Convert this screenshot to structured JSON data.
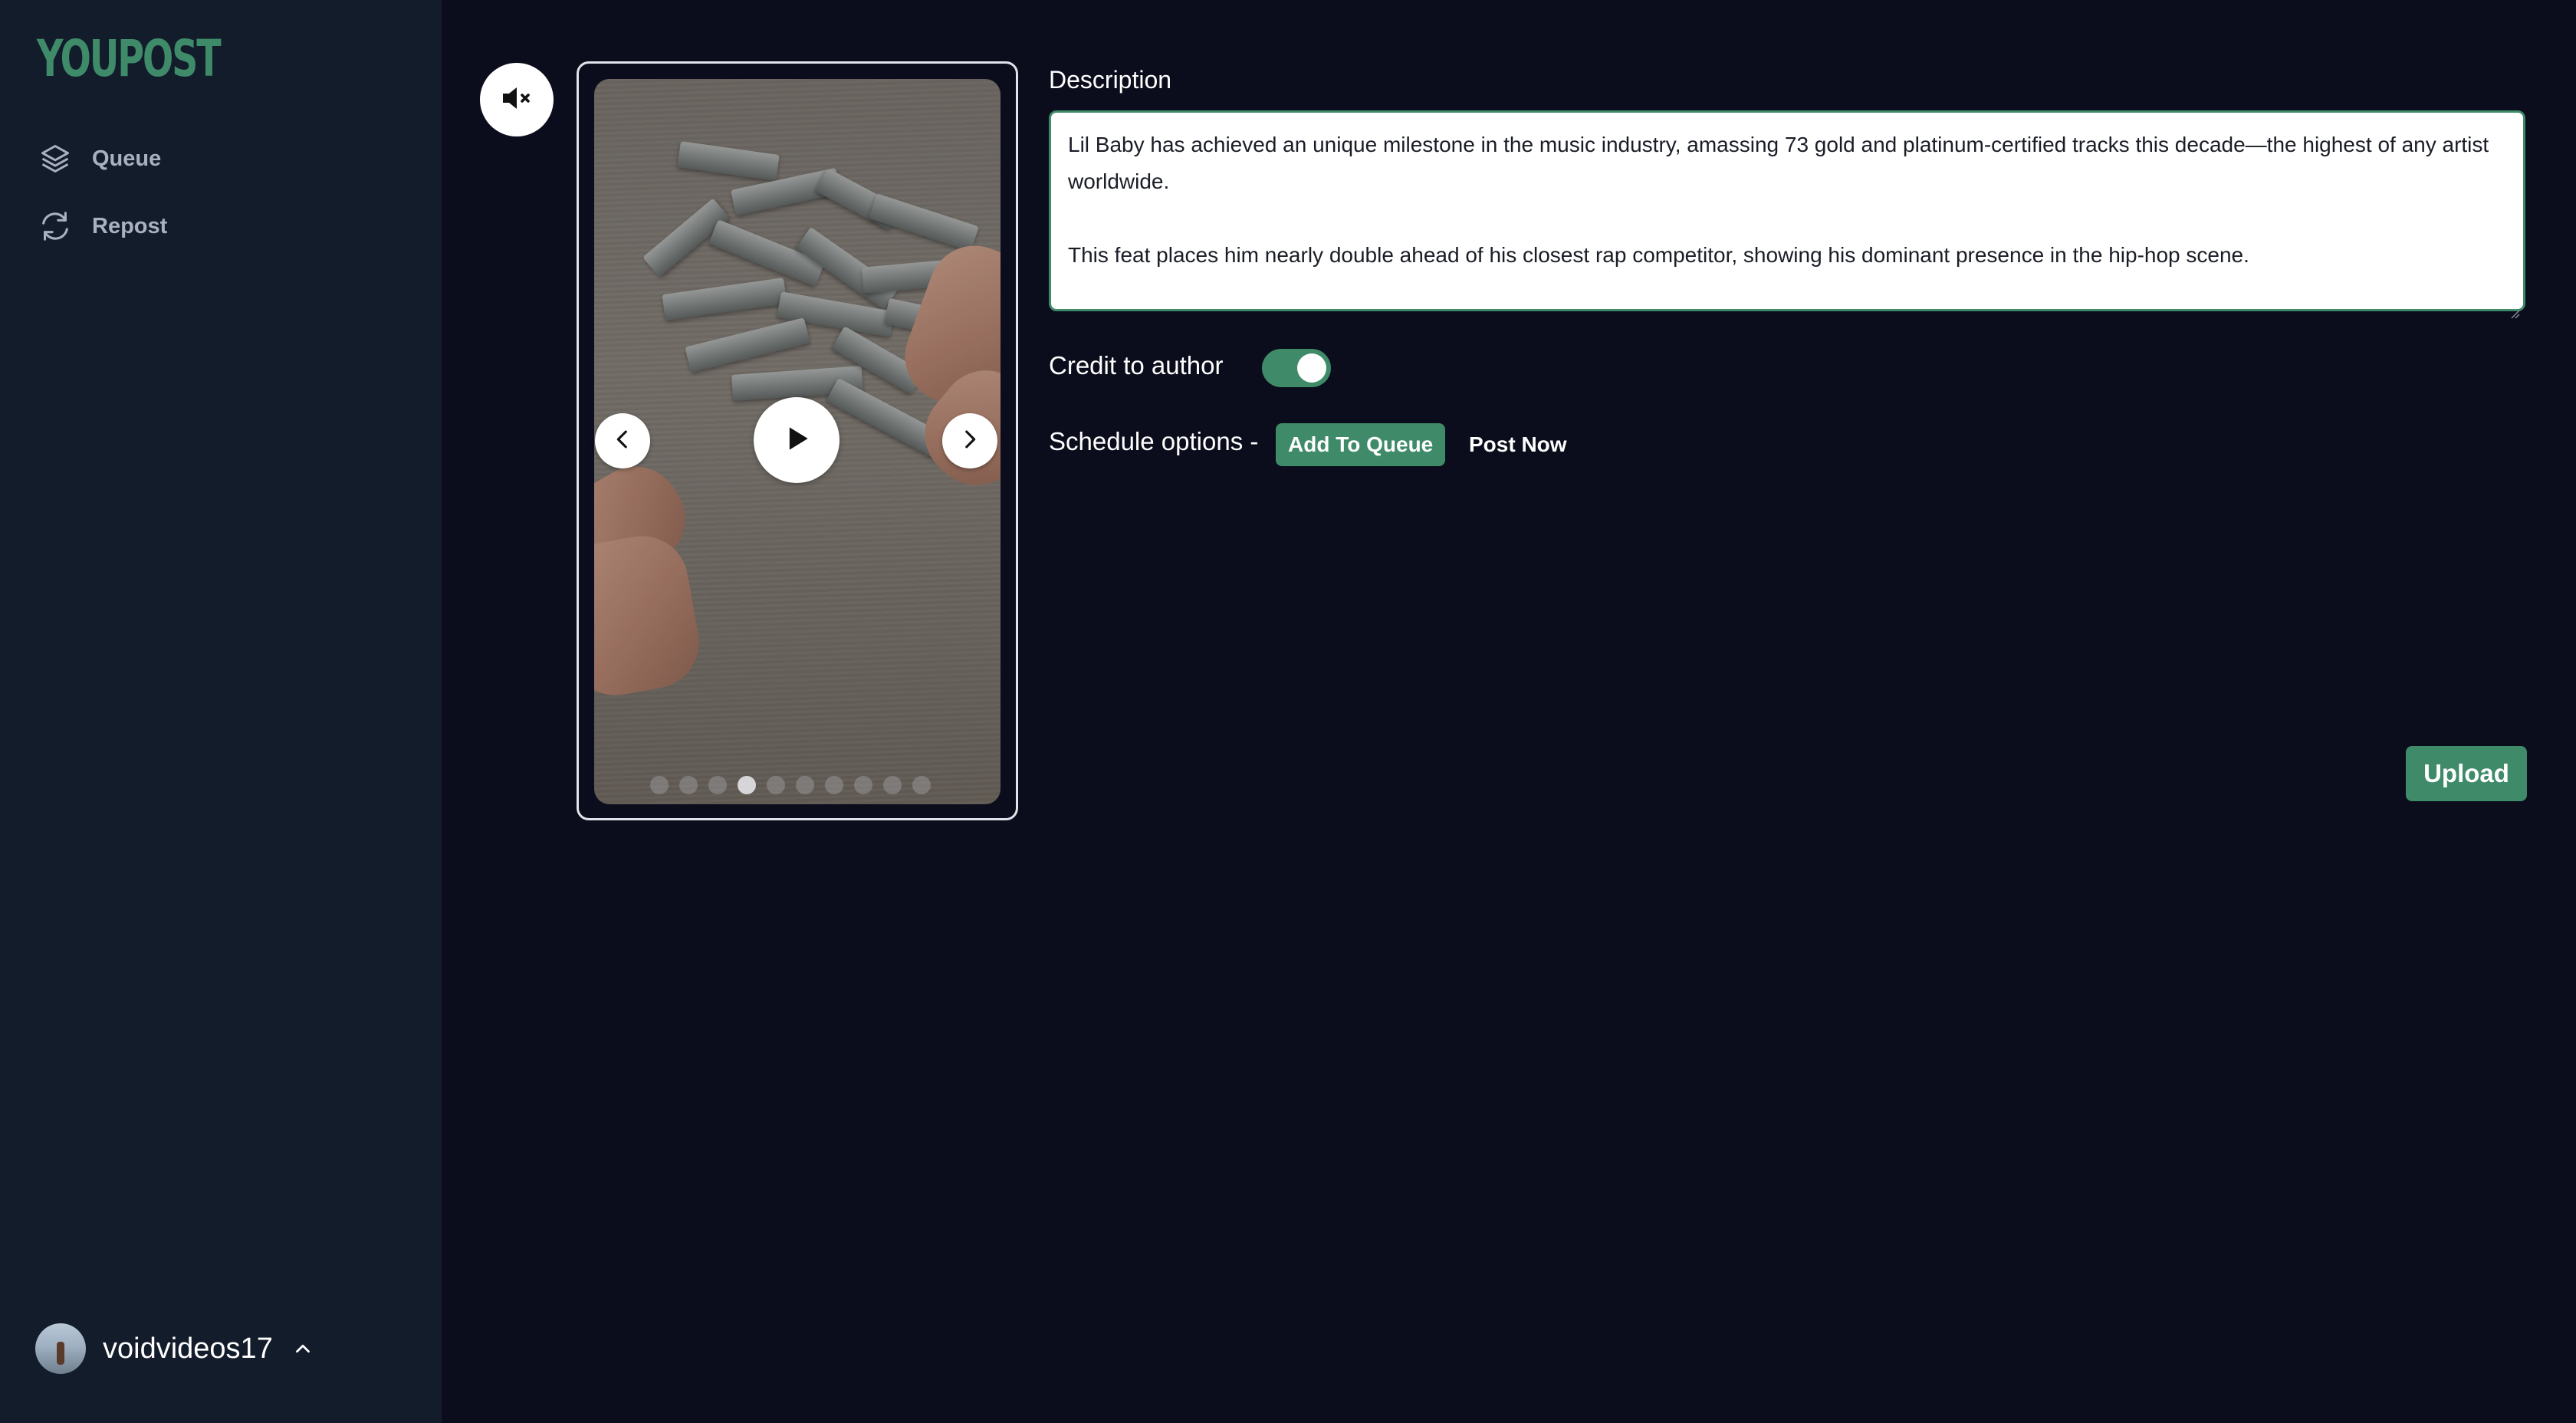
{
  "app": {
    "logo_text": "YOUPOST",
    "brand_color": "#3e8a69"
  },
  "sidebar": {
    "items": [
      {
        "label": "Queue",
        "icon": "layers-icon"
      },
      {
        "label": "Repost",
        "icon": "repost-icon"
      }
    ],
    "user": {
      "username": "voidvideos17",
      "menu_icon": "chevron-up-icon"
    }
  },
  "preview": {
    "mute_icon": "speaker-muted-icon",
    "prev_icon": "chevron-left-icon",
    "next_icon": "chevron-right-icon",
    "play_icon": "play-icon",
    "slide_count": 10,
    "active_slide": 4
  },
  "form": {
    "description_label": "Description",
    "description_paragraph_1": "Lil Baby has achieved an unique milestone in the music industry, amassing 73 gold and platinum-certified tracks this decade—the highest of any artist worldwide.",
    "description_paragraph_2": "This feat places him nearly double ahead of his closest rap competitor, showing his dominant presence in the hip-hop scene.",
    "credit_label": "Credit to author",
    "credit_enabled": true,
    "schedule_label": "Schedule options -",
    "add_to_queue_label": "Add To Queue",
    "post_now_label": "Post Now",
    "upload_label": "Upload"
  }
}
